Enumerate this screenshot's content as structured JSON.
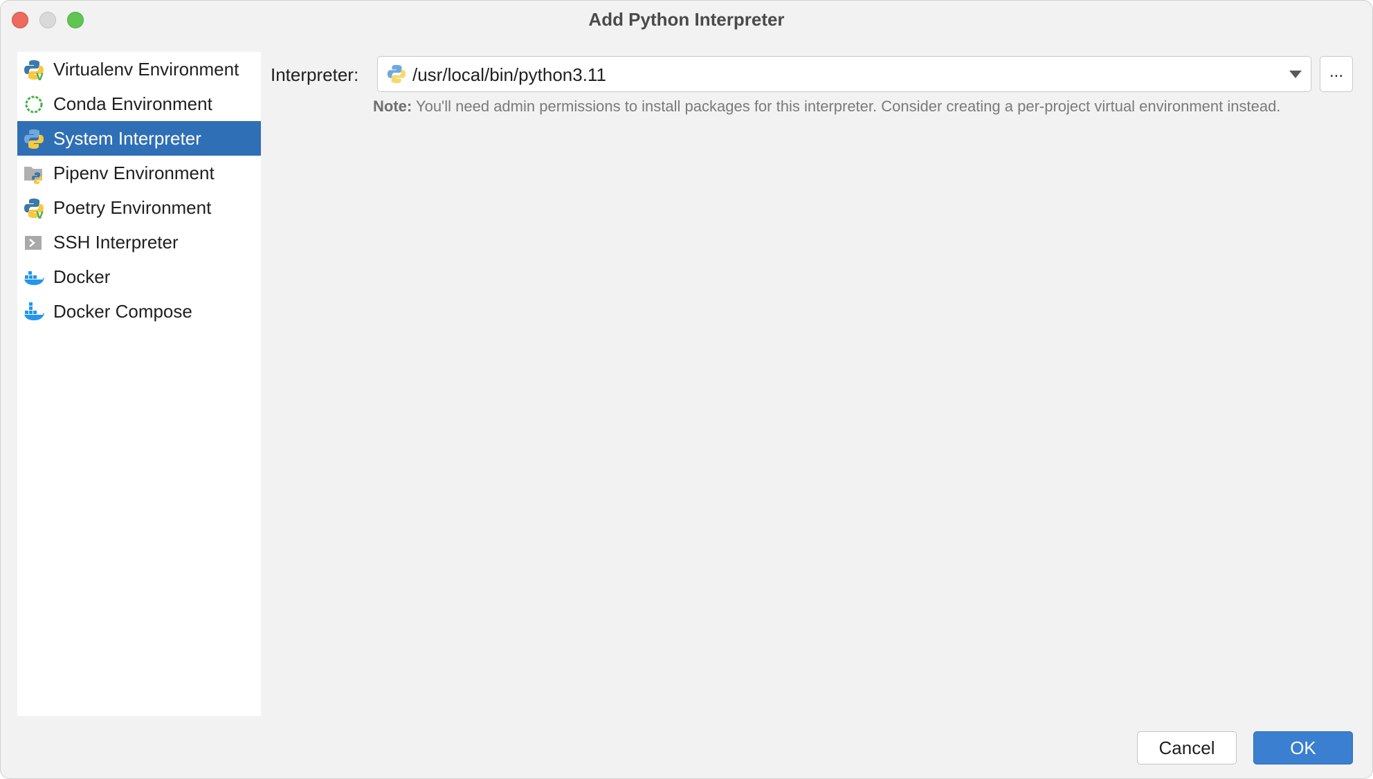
{
  "window": {
    "title": "Add Python Interpreter"
  },
  "sidebar": {
    "items": [
      {
        "label": "Virtualenv Environment",
        "icon": "python-venv-icon",
        "selected": false
      },
      {
        "label": "Conda Environment",
        "icon": "conda-icon",
        "selected": false
      },
      {
        "label": "System Interpreter",
        "icon": "python-icon",
        "selected": true
      },
      {
        "label": "Pipenv Environment",
        "icon": "pipenv-icon",
        "selected": false
      },
      {
        "label": "Poetry Environment",
        "icon": "poetry-icon",
        "selected": false
      },
      {
        "label": "SSH Interpreter",
        "icon": "ssh-terminal-icon",
        "selected": false
      },
      {
        "label": "Docker",
        "icon": "docker-icon",
        "selected": false
      },
      {
        "label": "Docker Compose",
        "icon": "docker-compose-icon",
        "selected": false
      }
    ]
  },
  "main": {
    "interpreter_label": "Interpreter:",
    "interpreter_value": "/usr/local/bin/python3.11",
    "browse_label": "...",
    "note_prefix": "Note:",
    "note_text": " You'll need admin permissions to install packages for this interpreter. Consider creating a per-project virtual environment instead."
  },
  "footer": {
    "cancel_label": "Cancel",
    "ok_label": "OK"
  },
  "colors": {
    "selected_bg": "#2f6fb6",
    "ok_bg": "#3a7fd0",
    "python_blue": "#3c78aa",
    "python_yellow": "#f7c93e",
    "docker_blue": "#2496ed"
  }
}
